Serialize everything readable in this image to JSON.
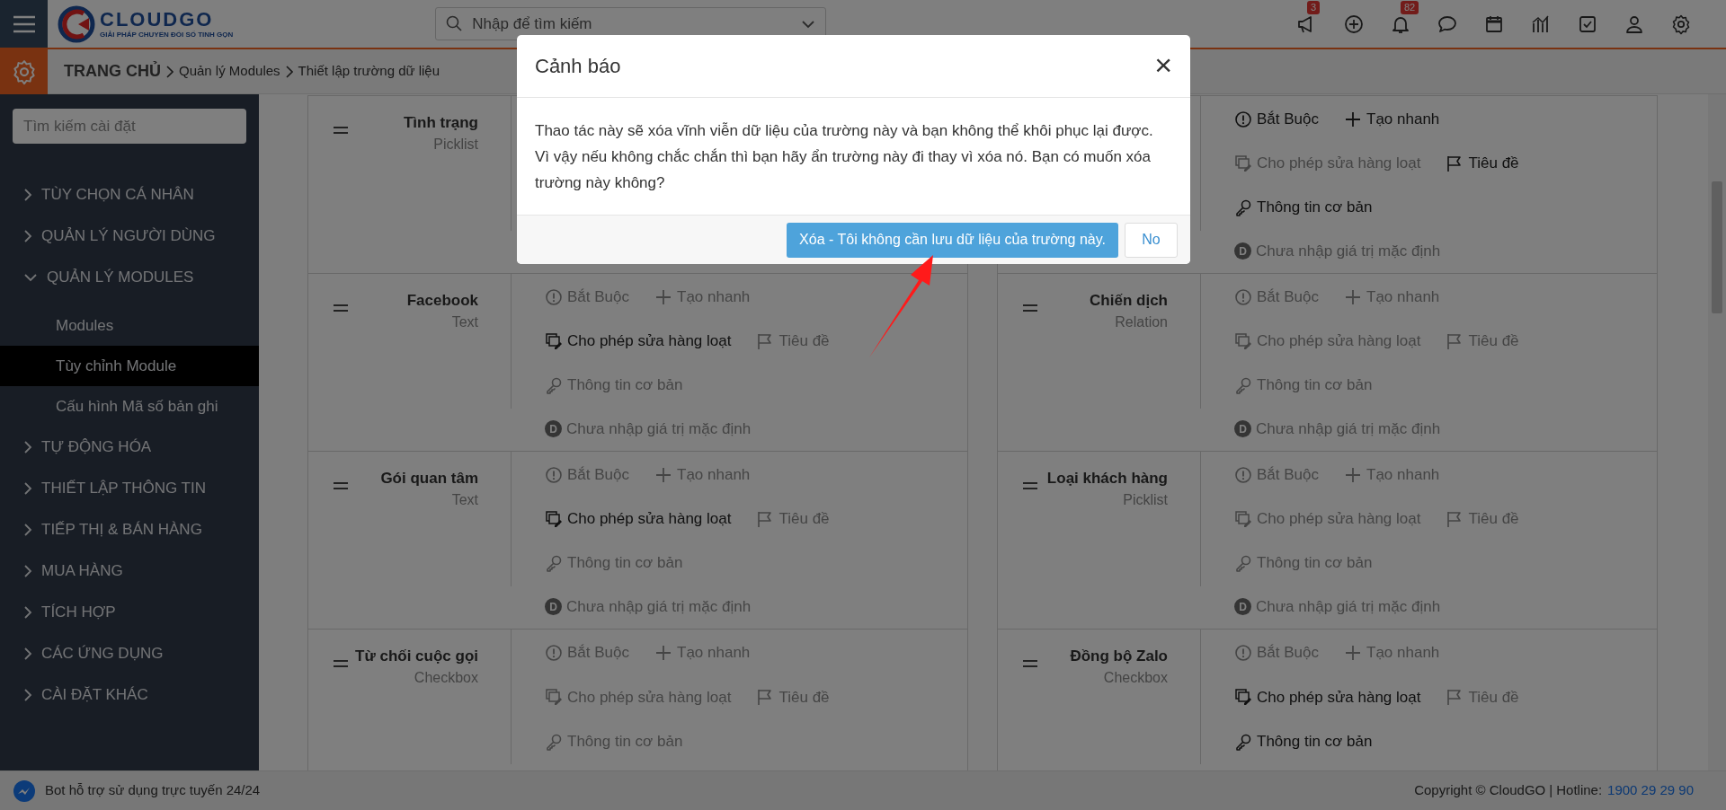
{
  "header": {
    "logo": {
      "name": "CLOUDGO",
      "tagline": "GIẢI PHÁP CHUYỂN ĐỔI SỐ TINH GỌN"
    },
    "search": {
      "placeholder": "Nhập để tìm kiếm"
    },
    "toolbar": [
      {
        "kind": "megaphone",
        "badge": "3"
      },
      {
        "kind": "add"
      },
      {
        "kind": "bell",
        "badge": "82"
      },
      {
        "kind": "chat"
      },
      {
        "kind": "calendar"
      },
      {
        "kind": "chart"
      },
      {
        "kind": "tasks"
      },
      {
        "kind": "user"
      },
      {
        "kind": "settings"
      }
    ]
  },
  "breadcrumb": [
    "TRANG CHỦ",
    "Quản lý Modules",
    "Thiết lập trường dữ liệu"
  ],
  "sidebar": {
    "search_placeholder": "Tìm kiếm cài đặt",
    "items": [
      {
        "label": "TÙY CHỌN CÁ NHÂN",
        "expanded": false
      },
      {
        "label": "QUẢN LÝ NGƯỜI DÙNG",
        "expanded": false
      },
      {
        "label": "QUẢN LÝ MODULES",
        "expanded": true,
        "children": [
          {
            "label": "Modules",
            "selected": false
          },
          {
            "label": "Tùy chỉnh Module",
            "selected": true
          },
          {
            "label": "Cấu hình Mã số bản ghi",
            "selected": false
          }
        ]
      },
      {
        "label": "TỰ ĐỘNG HÓA",
        "expanded": false
      },
      {
        "label": "THIẾT LẬP THÔNG TIN",
        "expanded": false
      },
      {
        "label": "TIẾP THỊ & BÁN HÀNG",
        "expanded": false
      },
      {
        "label": "MUA HÀNG",
        "expanded": false
      },
      {
        "label": "TÍCH HỢP",
        "expanded": false
      },
      {
        "label": "CÁC ỨNG DỤNG",
        "expanded": false
      },
      {
        "label": "CÀI ĐẶT KHÁC",
        "expanded": false
      }
    ]
  },
  "field_cards": [
    {
      "label": "Tình trạng",
      "type": "Picklist"
    },
    {
      "lines": [
        [
          {
            "kind": "required",
            "label": "Bắt Buộc",
            "on": true
          },
          {
            "kind": "quick_create",
            "label": "Tạo nhanh",
            "on": true
          }
        ],
        [
          {
            "kind": "mass_edit",
            "label": "Cho phép sửa hàng loạt",
            "on": false
          },
          {
            "kind": "header",
            "label": "Tiêu đề",
            "on": true
          }
        ],
        [
          {
            "kind": "key_info",
            "label": "Thông tin cơ bản",
            "on": true
          }
        ],
        [
          {
            "kind": "default",
            "badge": "D",
            "label": "Chưa nhập giá trị mặc định",
            "on": false
          }
        ]
      ]
    },
    {
      "label": "Facebook",
      "type": "Text",
      "lines": [
        [
          {
            "kind": "required",
            "label": "Bắt Buộc",
            "on": false
          },
          {
            "kind": "quick_create",
            "label": "Tạo nhanh",
            "on": false
          }
        ],
        [
          {
            "kind": "mass_edit",
            "label": "Cho phép sửa hàng loạt",
            "on": true
          },
          {
            "kind": "header",
            "label": "Tiêu đề",
            "on": false
          }
        ],
        [
          {
            "kind": "key_info",
            "label": "Thông tin cơ bản",
            "on": false
          }
        ],
        [
          {
            "kind": "default",
            "badge": "D",
            "label": "Chưa nhập giá trị mặc định",
            "on": false
          }
        ]
      ]
    },
    {
      "label": "Chiến dịch",
      "type": "Relation",
      "lines": [
        [
          {
            "kind": "required",
            "label": "Bắt Buộc",
            "on": false
          },
          {
            "kind": "quick_create",
            "label": "Tạo nhanh",
            "on": false
          }
        ],
        [
          {
            "kind": "mass_edit",
            "label": "Cho phép sửa hàng loạt",
            "on": false
          },
          {
            "kind": "header",
            "label": "Tiêu đề",
            "on": false
          }
        ],
        [
          {
            "kind": "key_info",
            "label": "Thông tin cơ bản",
            "on": false
          }
        ],
        [
          {
            "kind": "default",
            "badge": "D",
            "label": "Chưa nhập giá trị mặc định",
            "on": false
          }
        ]
      ]
    },
    {
      "label": "Gói quan tâm",
      "type": "Text",
      "lines": [
        [
          {
            "kind": "required",
            "label": "Bắt Buộc",
            "on": false
          },
          {
            "kind": "quick_create",
            "label": "Tạo nhanh",
            "on": false
          }
        ],
        [
          {
            "kind": "mass_edit",
            "label": "Cho phép sửa hàng loạt",
            "on": true
          },
          {
            "kind": "header",
            "label": "Tiêu đề",
            "on": false
          }
        ],
        [
          {
            "kind": "key_info",
            "label": "Thông tin cơ bản",
            "on": false
          }
        ],
        [
          {
            "kind": "default",
            "badge": "D",
            "label": "Chưa nhập giá trị mặc định",
            "on": false
          }
        ]
      ]
    },
    {
      "label": "Loại khách hàng",
      "type": "Picklist",
      "lines": [
        [
          {
            "kind": "required",
            "label": "Bắt Buộc",
            "on": false
          },
          {
            "kind": "quick_create",
            "label": "Tạo nhanh",
            "on": false
          }
        ],
        [
          {
            "kind": "mass_edit",
            "label": "Cho phép sửa hàng loạt",
            "on": false
          },
          {
            "kind": "header",
            "label": "Tiêu đề",
            "on": false
          }
        ],
        [
          {
            "kind": "key_info",
            "label": "Thông tin cơ bản",
            "on": false
          }
        ],
        [
          {
            "kind": "default",
            "badge": "D",
            "label": "Chưa nhập giá trị mặc định",
            "on": false
          }
        ]
      ]
    },
    {
      "label": "Từ chối cuộc gọi",
      "type": "Checkbox",
      "lines": [
        [
          {
            "kind": "required",
            "label": "Bắt Buộc",
            "on": false
          },
          {
            "kind": "quick_create",
            "label": "Tạo nhanh",
            "on": false
          }
        ],
        [
          {
            "kind": "mass_edit",
            "label": "Cho phép sửa hàng loạt",
            "on": false
          },
          {
            "kind": "header",
            "label": "Tiêu đề",
            "on": false
          }
        ],
        [
          {
            "kind": "key_info",
            "label": "Thông tin cơ bản",
            "on": false
          }
        ]
      ]
    },
    {
      "label": "Đồng bộ Zalo",
      "type": "Checkbox",
      "lines": [
        [
          {
            "kind": "required",
            "label": "Bắt Buộc",
            "on": false
          },
          {
            "kind": "quick_create",
            "label": "Tạo nhanh",
            "on": false
          }
        ],
        [
          {
            "kind": "mass_edit",
            "label": "Cho phép sửa hàng loạt",
            "on": true
          },
          {
            "kind": "header",
            "label": "Tiêu đề",
            "on": false
          }
        ],
        [
          {
            "kind": "key_info",
            "label": "Thông tin cơ bản",
            "on": true
          }
        ]
      ]
    }
  ],
  "footer": {
    "bot": "Bot hỗ trợ sử dụng trực tuyến 24/24",
    "copyright": "Copyright © CloudGO",
    "separator": "|",
    "hotline_label": "Hotline:",
    "hotline": "1900 29 29 90"
  },
  "dialog": {
    "title": "Cảnh báo",
    "close": "×",
    "message": "Thao tác này sẽ xóa vĩnh viễn dữ liệu của trường này và bạn không thể khôi phục lại được. Vì vậy nếu không chắc chắn thì bạn hãy ẩn trường này đi thay vì xóa nó. Bạn có muốn xóa trường này không?",
    "confirm": "Xóa - Tôi không cần lưu dữ liệu của trường này.",
    "cancel": "No"
  }
}
